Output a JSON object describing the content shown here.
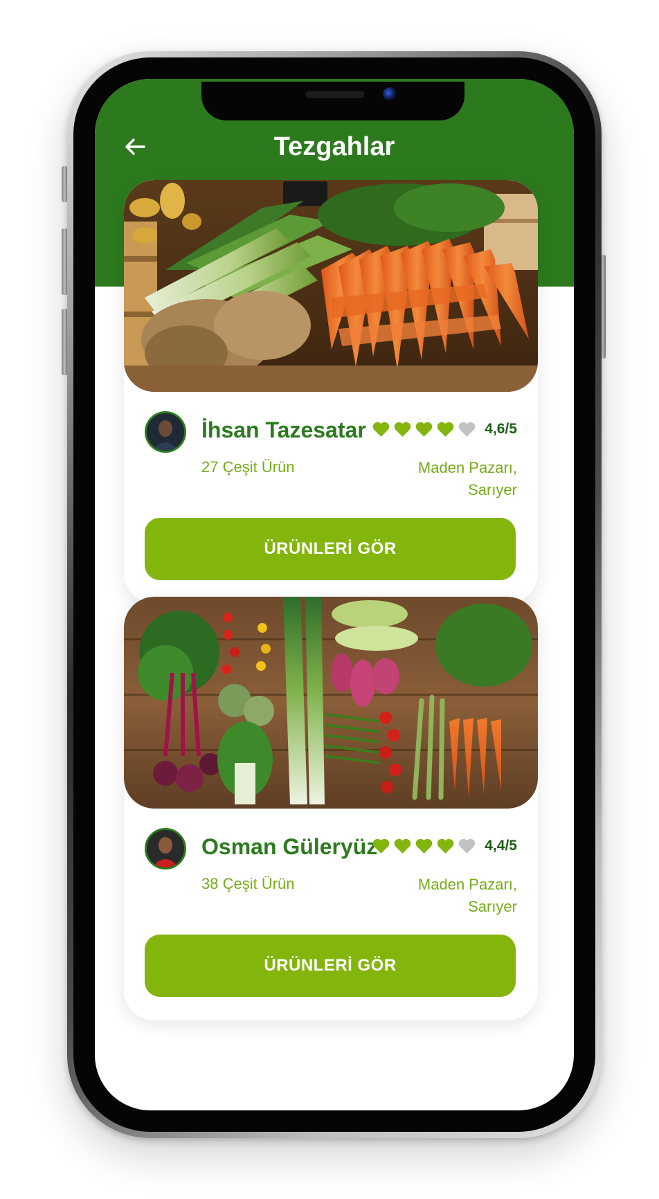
{
  "header": {
    "title": "Tezgahlar",
    "back_icon": "arrow-left-icon"
  },
  "colors": {
    "header_green": "#2d7a1e",
    "name_green": "#2d7a1e",
    "accent_green": "#83b50d",
    "text_light_green": "#74ad17",
    "heart_active": "#83b50d",
    "heart_inactive": "#c2c2c2"
  },
  "stalls": [
    {
      "vendor_name": "İhsan Tazesatar",
      "rating_text": "4,6/5",
      "hearts_filled": 4,
      "hearts_total": 5,
      "product_count": "27 Çeşit Ürün",
      "location_line1": "Maden Pazarı,",
      "location_line2": "Sarıyer",
      "button_label": "ÜRÜNLERİ GÖR"
    },
    {
      "vendor_name": "Osman Güleryüz",
      "rating_text": "4,4/5",
      "hearts_filled": 4,
      "hearts_total": 5,
      "product_count": "38 Çeşit Ürün",
      "location_line1": "Maden Pazarı,",
      "location_line2": "Sarıyer",
      "button_label": "ÜRÜNLERİ GÖR"
    }
  ]
}
